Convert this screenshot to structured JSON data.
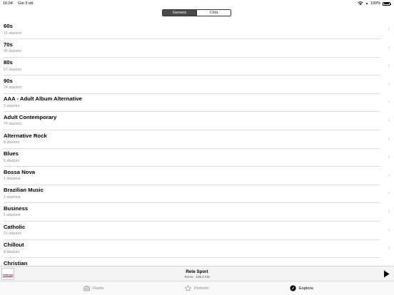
{
  "status_bar": {
    "time": "16:04",
    "date": "Gio 3 ott",
    "battery": "100%"
  },
  "segmented": {
    "genre": "Genere",
    "city": "Città"
  },
  "genres": [
    {
      "name": "60s",
      "count": "15 stazioni"
    },
    {
      "name": "70s",
      "count": "36 stazioni"
    },
    {
      "name": "80s",
      "count": "57 stazioni"
    },
    {
      "name": "90s",
      "count": "24 stazioni"
    },
    {
      "name": "AAA - Adult Album Alternative",
      "count": "2 stazioni"
    },
    {
      "name": "Adult Contemporary",
      "count": "74 stazioni"
    },
    {
      "name": "Alternative Rock",
      "count": "8 stazioni"
    },
    {
      "name": "Blues",
      "count": "6 stazioni"
    },
    {
      "name": "Bossa Nova",
      "count": "1 stazione"
    },
    {
      "name": "Brazilian Music",
      "count": "1 stazione"
    },
    {
      "name": "Business",
      "count": "1 stazione"
    },
    {
      "name": "Catholic",
      "count": "21 stazioni"
    },
    {
      "name": "Chillout",
      "count": "8 stazioni"
    },
    {
      "name": "Christian",
      "count": ""
    }
  ],
  "player": {
    "title": "Rete Sport",
    "subtitle": "Roma - 105.0 FM",
    "logo_text_a": "rete",
    "logo_text_b": "sport",
    "logo_colors": {
      "primary": "#1d2f7a",
      "accent": "#d0202a"
    }
  },
  "tabs": [
    {
      "label": "Radio",
      "icon": "radio-icon",
      "active": false
    },
    {
      "label": "Preferiti",
      "icon": "star-icon",
      "active": false
    },
    {
      "label": "Esplora",
      "icon": "compass-icon",
      "active": true
    }
  ]
}
